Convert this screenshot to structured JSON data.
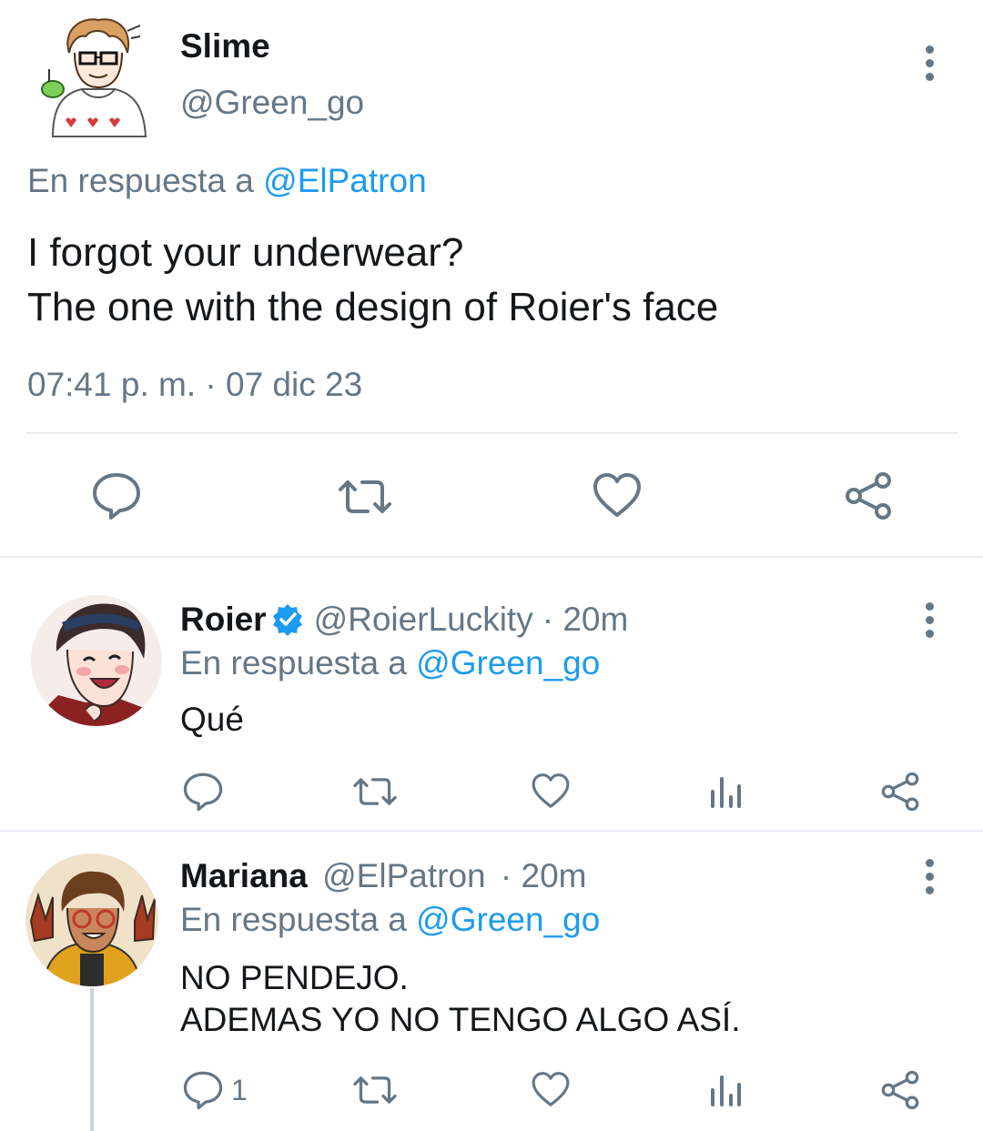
{
  "main_tweet": {
    "display_name": "Slime",
    "handle": "@Green_go",
    "reply_prefix": "En respuesta a ",
    "reply_to": "@ElPatron",
    "text_line1": "I forgot your underwear?",
    "text_line2": "The one with the design of Roier's face",
    "timestamp": "07:41 p. m. · 07 dic 23",
    "avatar_icon": "avatar-slime"
  },
  "replies": [
    {
      "display_name": "Roier",
      "verified": true,
      "handle": "@RoierLuckity",
      "time": "· 20m",
      "reply_prefix": "En respuesta a ",
      "reply_to": "@Green_go",
      "text_line1": "Qué",
      "text_line2": "",
      "reply_count": ""
    },
    {
      "display_name": "Mariana",
      "verified": false,
      "handle": "@ElPatron",
      "time": "· 20m",
      "reply_prefix": "En respuesta a ",
      "reply_to": "@Green_go",
      "text_line1": "NO PENDEJO.",
      "text_line2": "ADEMAS YO NO TENGO ALGO ASÍ.",
      "reply_count": "1"
    }
  ],
  "icons": [
    "more-options-icon",
    "reply-icon",
    "retweet-icon",
    "like-icon",
    "share-icon",
    "views-icon",
    "verified-badge-icon"
  ],
  "colors": {
    "accent": "#1d9bf0",
    "muted": "#657786",
    "text": "#14171a",
    "divider": "#e6ecf0"
  }
}
